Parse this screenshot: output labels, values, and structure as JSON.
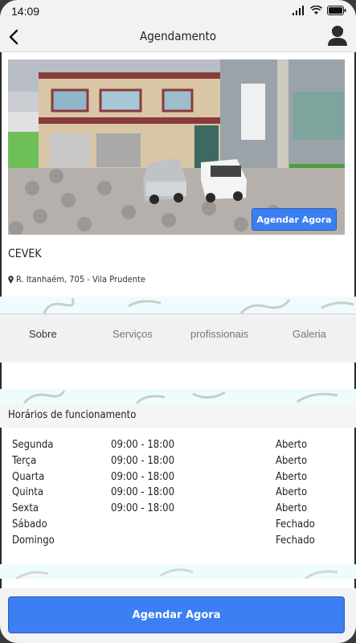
{
  "status_bar": {
    "time": "14:09"
  },
  "header": {
    "title": "Agendamento"
  },
  "photo": {
    "button_label": "Agendar Agora"
  },
  "business": {
    "name": "CEVEK",
    "address": "R. Itanhaém, 705 - Vila Prudente"
  },
  "tabs": [
    {
      "label": "Sobre",
      "active": true
    },
    {
      "label": "Serviços",
      "active": false
    },
    {
      "label": "profissionais",
      "active": false
    },
    {
      "label": "Galeria",
      "active": false
    }
  ],
  "hours": {
    "title": "Horários de funcionamento",
    "rows": [
      {
        "day": "Segunda",
        "time": "09:00 - 18:00",
        "status": "Aberto"
      },
      {
        "day": "Terça",
        "time": "09:00 - 18:00",
        "status": "Aberto"
      },
      {
        "day": "Quarta",
        "time": "09:00 - 18:00",
        "status": "Aberto"
      },
      {
        "day": "Quinta",
        "time": "09:00 - 18:00",
        "status": "Aberto"
      },
      {
        "day": "Sexta",
        "time": "09:00 - 18:00",
        "status": "Aberto"
      },
      {
        "day": "Sábado",
        "time": "",
        "status": "Fechado"
      },
      {
        "day": "Domingo",
        "time": "",
        "status": "Fechado"
      }
    ]
  },
  "cta": {
    "label": "Agendar Agora"
  },
  "colors": {
    "accent": "#3b7ff2",
    "background": "#ffffff",
    "deco": "#eefcfe"
  }
}
